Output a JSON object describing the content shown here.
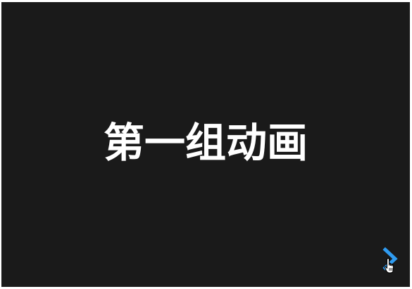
{
  "slide": {
    "title": "第一组动画",
    "background_color": "#1a1a1a",
    "title_color": "#ffffff"
  },
  "navigation": {
    "next_icon": "chevron-right-icon",
    "accent_color": "#2f9bf0"
  },
  "cursor": {
    "icon": "hand-pointer-icon"
  }
}
